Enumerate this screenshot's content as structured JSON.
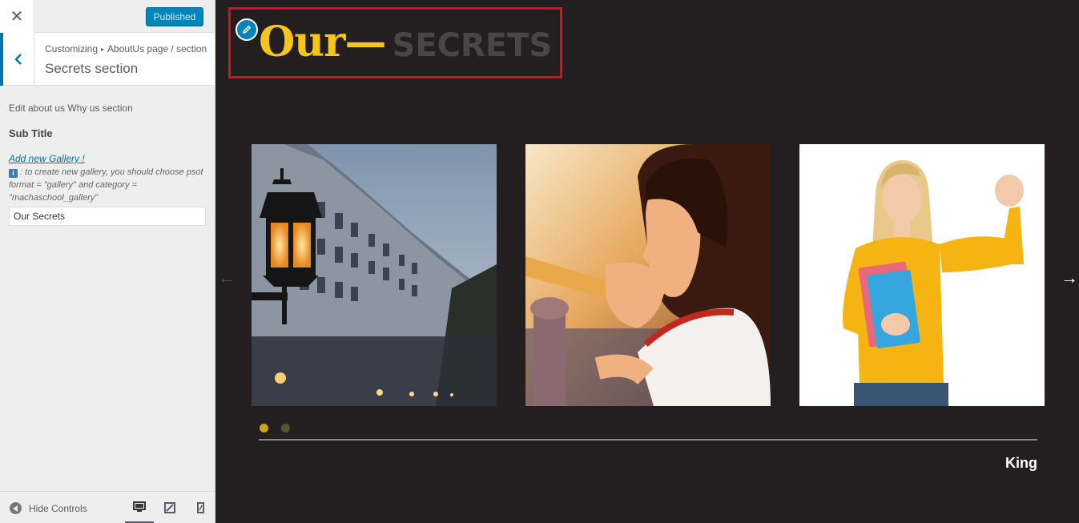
{
  "topbar": {
    "close_icon": "close-icon",
    "publish_label": "Published",
    "accent_color": "#0085ba"
  },
  "section_header": {
    "breadcrumb_root": "Customizing",
    "breadcrumb_path": "AboutUs page / section",
    "title": "Secrets section"
  },
  "controls": {
    "description": "Edit about us Why us section",
    "sub_title_label": "Sub Title",
    "gallery_link": "Add new Gallery !",
    "gallery_note": ": to create new gallery, you should choose psot format = \"gallery\" and category = \"machaschool_gallery\"",
    "title_value": "Our Secrets"
  },
  "footer": {
    "hide_controls_label": "Hide Controls",
    "devices": [
      "desktop",
      "tablet",
      "mobile"
    ],
    "active_device": "desktop"
  },
  "preview": {
    "heading_main": "Our—",
    "heading_sub": "SECRETS",
    "heading_color": "#f5c518",
    "photos": [
      "street-lamp-photo",
      "girl-sunset-photo",
      "student-with-books-photo"
    ],
    "prev_arrow": "←",
    "next_arrow": "→",
    "carousel_pages": 2,
    "active_page": 1,
    "author": "King"
  }
}
